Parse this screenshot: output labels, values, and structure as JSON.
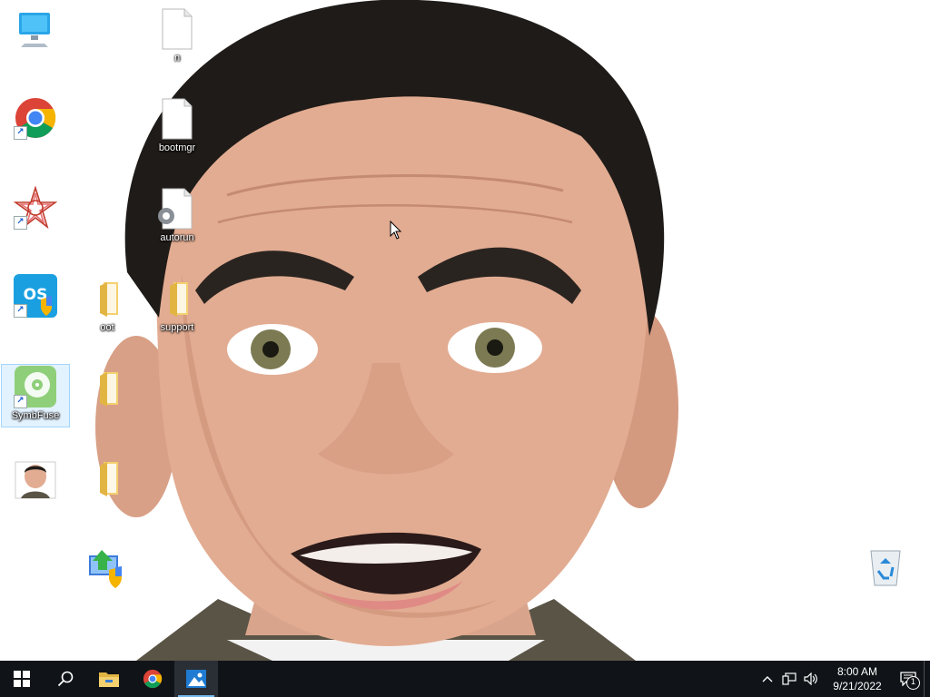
{
  "desktop": {
    "icons": [
      {
        "id": "this-pc",
        "label": ""
      },
      {
        "id": "chrome",
        "label": ""
      },
      {
        "id": "app-red-star",
        "label": ""
      },
      {
        "id": "app-os-shield",
        "label": ""
      },
      {
        "id": "symbfuse",
        "label": "SymbFuse"
      },
      {
        "id": "photo-file",
        "label": ""
      },
      {
        "id": "folder-boot",
        "label": "oot"
      },
      {
        "id": "folder-2",
        "label": ""
      },
      {
        "id": "folder-3",
        "label": ""
      },
      {
        "id": "setup-shield",
        "label": ""
      },
      {
        "id": "file-top",
        "label": "n"
      },
      {
        "id": "bootmgr",
        "label": "bootmgr"
      },
      {
        "id": "autorun",
        "label": "autorun"
      },
      {
        "id": "support",
        "label": "support"
      },
      {
        "id": "recycle-bin",
        "label": ""
      }
    ]
  },
  "taskbar": {
    "clock": {
      "time": "8:00 AM",
      "date": "9/21/2022"
    },
    "notification_count": "1"
  },
  "colors": {
    "taskbar_bg": "#101418",
    "accent": "#76b9ed"
  }
}
